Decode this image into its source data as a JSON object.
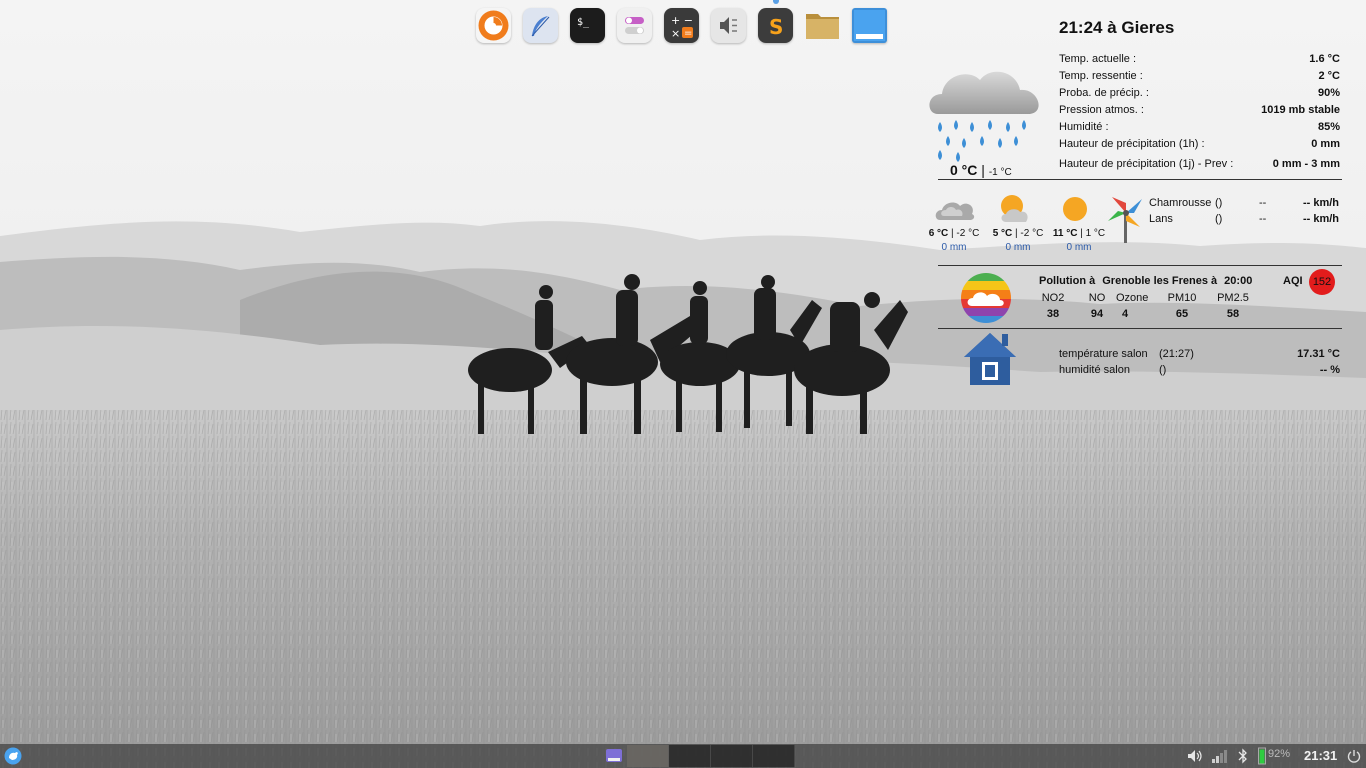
{
  "dock": {
    "apps": [
      {
        "name": "firefox",
        "icon": "firefox-icon"
      },
      {
        "name": "feather-editor",
        "icon": "feather-icon"
      },
      {
        "name": "terminal",
        "icon": "terminal-icon"
      },
      {
        "name": "settings-toggles",
        "icon": "toggles-icon"
      },
      {
        "name": "calculator",
        "icon": "calculator-icon"
      },
      {
        "name": "sound-mute",
        "icon": "speaker-mute-icon"
      },
      {
        "name": "sublime-text",
        "icon": "sublime-icon"
      },
      {
        "name": "file-manager",
        "icon": "folder-icon"
      },
      {
        "name": "window-app",
        "icon": "window-icon"
      }
    ]
  },
  "conky": {
    "clock_line": "21:24 à Gieres",
    "current": [
      {
        "label": "Temp. actuelle :",
        "value": "1.6 °C"
      },
      {
        "label": "Temp. ressentie :",
        "value": "2 °C"
      },
      {
        "label": "Proba. de précip. :",
        "value": "90%"
      },
      {
        "label": "Pression atmos. :",
        "value": "1019 mb stable"
      },
      {
        "label": "Humidité :",
        "value": "85%"
      },
      {
        "label": "Hauteur de précipitation (1h) :",
        "value": "0  mm"
      },
      {
        "label": "Hauteur de précipitation (1j) - Prev :",
        "value": "0  mm - 3 mm"
      }
    ],
    "now": {
      "temp": "0 °C",
      "sep": "|",
      "feels": "-1 °C"
    },
    "forecast": [
      {
        "high": "6 °C",
        "sep": "|",
        "low": "-2 °C",
        "rain": "0 mm",
        "icon": "cloudy-icon"
      },
      {
        "high": "5 °C",
        "sep": "|",
        "low": "-2 °C",
        "rain": "0 mm",
        "icon": "partly-sunny-icon"
      },
      {
        "high": "11 °C",
        "sep": "|",
        "low": "1 °C",
        "rain": "0 mm",
        "icon": "sunny-icon"
      }
    ],
    "wind": [
      {
        "station": "Chamrousse",
        "dir": "()",
        "speed": "--",
        "unit": "-- km/h"
      },
      {
        "station": "Lans",
        "dir": "()",
        "speed": "--",
        "unit": "-- km/h"
      }
    ],
    "pollution": {
      "head": [
        "Pollution à",
        "Grenoble les Frenes à",
        "20:00"
      ],
      "aqi_label": "AQI",
      "aqi_value": "152",
      "aqi_color": "#e21c1c",
      "columns": [
        {
          "label": "NO2",
          "value": "38"
        },
        {
          "label": "NO",
          "value": "94"
        },
        {
          "label": "Ozone",
          "value": "4"
        },
        {
          "label": "PM10",
          "value": "65"
        },
        {
          "label": "PM2.5",
          "value": "58"
        }
      ]
    },
    "home": [
      {
        "label": "température salon",
        "when": "(21:27)",
        "value": "17.31 °C"
      },
      {
        "label": "humidité salon",
        "when": "()",
        "value": "-- %"
      }
    ]
  },
  "panel": {
    "clock": "21:31",
    "battery_pct": "92%",
    "battery_color": "#2ecc40",
    "workspaces": 4,
    "active_workspace": 1
  }
}
